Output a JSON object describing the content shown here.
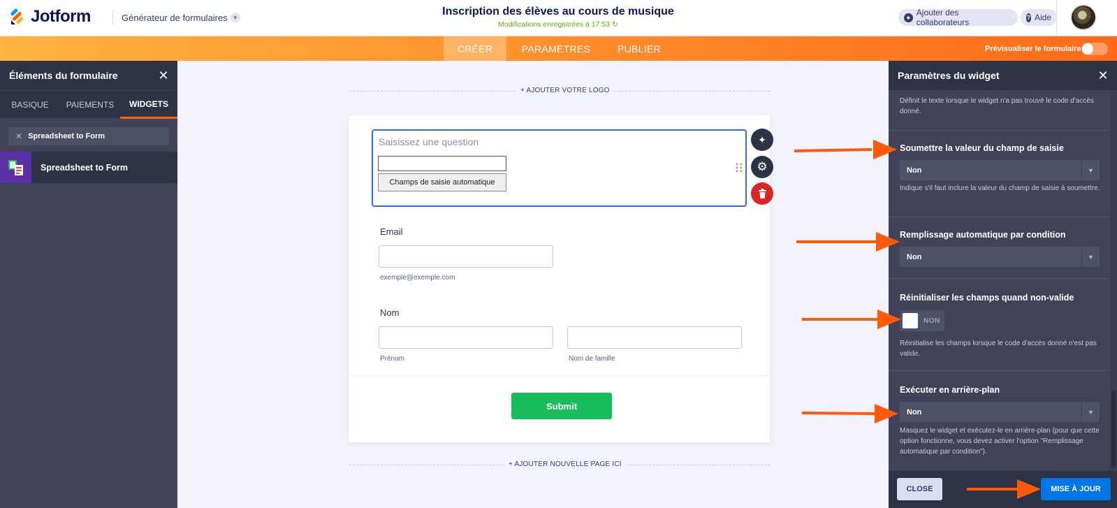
{
  "header": {
    "logo_text": "Jotform",
    "builder_label": "Générateur de formulaires",
    "form_title": "Inscription des élèves au cours de musique",
    "save_status": "Modifications enregistrées à 17:53",
    "add_collaborators": "Ajouter des collaborateurs",
    "help": "Aide"
  },
  "nav": {
    "tabs": [
      "CRÉER",
      "PARAMÈTRES",
      "PUBLIER"
    ],
    "active_tab": "CRÉER",
    "preview_label": "Prévisualiser le formulaire",
    "preview_on": false
  },
  "left_panel": {
    "title": "Éléments du formulaire",
    "tabs": [
      "BASIQUE",
      "PAIEMENTS",
      "WIDGETS"
    ],
    "active_tab": "WIDGETS",
    "search_value": "Spreadsheet to Form",
    "items": [
      {
        "label": "Spreadsheet to Form",
        "icon": "spreadsheet-icon"
      }
    ]
  },
  "form": {
    "add_logo": "+ AJOUTER VOTRE LOGO",
    "widget_question_placeholder": "Saisissez une question",
    "widget_button": "Champs de saisie automatique",
    "email_label": "Email",
    "email_sublabel": "exemple@exemple.com",
    "name_label": "Nom",
    "first_name_sublabel": "Prénom",
    "last_name_sublabel": "Nom de famille",
    "submit": "Submit",
    "add_page": "+ AJOUTER NOUVELLE PAGE ICI"
  },
  "right_panel": {
    "title": "Paramètres du widget",
    "top_desc": "Définit le texte lorsque le widget n'a pas trouvé le code d'accès donné.",
    "settings": [
      {
        "title": "Soumettre la valeur du champ de saisie",
        "value": "Non",
        "desc": "Indique s'il faut inclure la valeur du champ de saisie à soumettre."
      },
      {
        "title": "Remplissage automatique par condition",
        "value": "Non",
        "desc": ""
      },
      {
        "title": "Réinitialiser les champs quand non-valide",
        "value": "NON",
        "desc": "Réinitialise les champs lorsque le code d'accès donné n'est pas valide."
      },
      {
        "title": "Exécuter en arrière-plan",
        "value": "Non",
        "desc": "Masquez le widget et exécutez-le en arrière-plan (pour que cette option fonctionne, vous devez activer l'option \"Remplissage automatique par condition\")."
      }
    ],
    "close_button": "CLOSE",
    "update_button": "MISE À JOUR"
  },
  "colors": {
    "accent_orange": "#ff6100",
    "brand_navy": "#0a1551",
    "panel_dark": "#404358",
    "submit_green": "#18bd5b",
    "update_blue": "#0075e3",
    "save_green": "#64b200"
  }
}
